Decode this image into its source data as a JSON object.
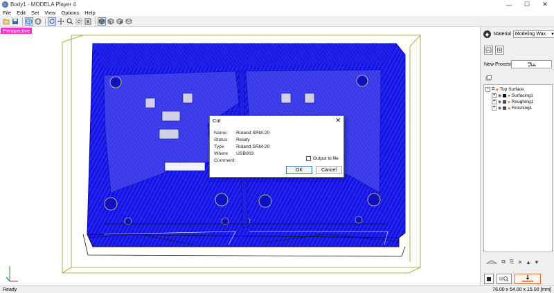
{
  "window": {
    "title": "Body1 - MODELA Player 4",
    "minimize": "—",
    "maximize": "☐",
    "close": "✕"
  },
  "menu": [
    "File",
    "Edit",
    "Set",
    "View",
    "Options",
    "Help"
  ],
  "viewport": {
    "label": "Perspective",
    "label_color": "#ff2bd6",
    "toolpath_color": "#1515e8"
  },
  "panel": {
    "material_label": "Material",
    "material_value": "Modeling Wax",
    "new_process_label": "New Process",
    "tree": [
      {
        "label": "Top Surface",
        "level": 0,
        "expander": "−"
      },
      {
        "label": "Surfacing1",
        "level": 1,
        "expander": "+"
      },
      {
        "label": "Roughing1",
        "level": 1,
        "expander": "+"
      },
      {
        "label": "Finishing1",
        "level": 1,
        "expander": "+"
      }
    ]
  },
  "dialog": {
    "title": "Cut",
    "close": "✕",
    "fields": [
      {
        "key": "Name:",
        "value": "Roland SRM-20"
      },
      {
        "key": "Status:",
        "value": "Ready"
      },
      {
        "key": "Type",
        "value": "Roland SRM-20"
      },
      {
        "key": "Where",
        "value": "USB003"
      },
      {
        "key": "Comment:",
        "value": ""
      }
    ],
    "checkbox_label": "Output to file",
    "ok": "OK",
    "cancel": "Cancel"
  },
  "status": {
    "left": "Ready",
    "right": "76.00 x 54.00 x 15.00 [mm]"
  }
}
